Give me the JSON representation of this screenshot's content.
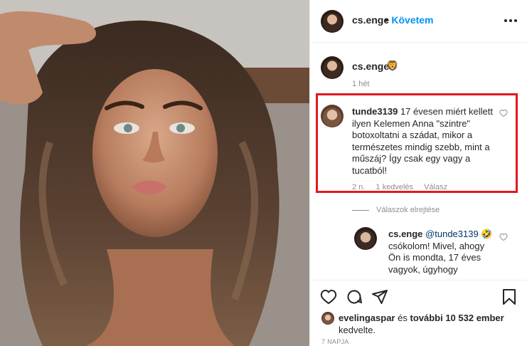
{
  "post": {
    "author": "cs.enge",
    "follow_dot": "•",
    "follow_label": "Követem",
    "caption_emoji": "🦁",
    "caption_time": "1 hét"
  },
  "comments": [
    {
      "username": "tunde3139",
      "text": "17 évesen miért kellett ilyen Kelemen Anna \"szintre\" botoxoltatni a szádat, mikor a természetes mindig szebb, mint a műszáj? Így csak egy vagy a tucatból!",
      "time": "2 n.",
      "likes": "1 kedvelés",
      "reply_label": "Válasz"
    }
  ],
  "hide_replies": "Válaszok elrejtése",
  "reply": {
    "username": "cs.enge",
    "mention": "@tunde3139",
    "emoji": "🤣",
    "text": "csókolom! Mivel, ahogy Ön is mondta, 17 éves vagyok, úgyhogy"
  },
  "likes": {
    "first_user": "evelingaspar",
    "and_text": "és",
    "others": "további 10 532 ember",
    "suffix": "kedvelte."
  },
  "date": "7 NAPJA",
  "colors": {
    "follow_blue": "#0095f6",
    "highlight_red": "#e0191f",
    "muted_gray": "#8e8e8e",
    "mention_blue": "#00376b"
  },
  "icons": [
    "more-horizontal-icon",
    "heart-outline-icon",
    "comment-icon",
    "share-direct-icon",
    "bookmark-icon"
  ]
}
